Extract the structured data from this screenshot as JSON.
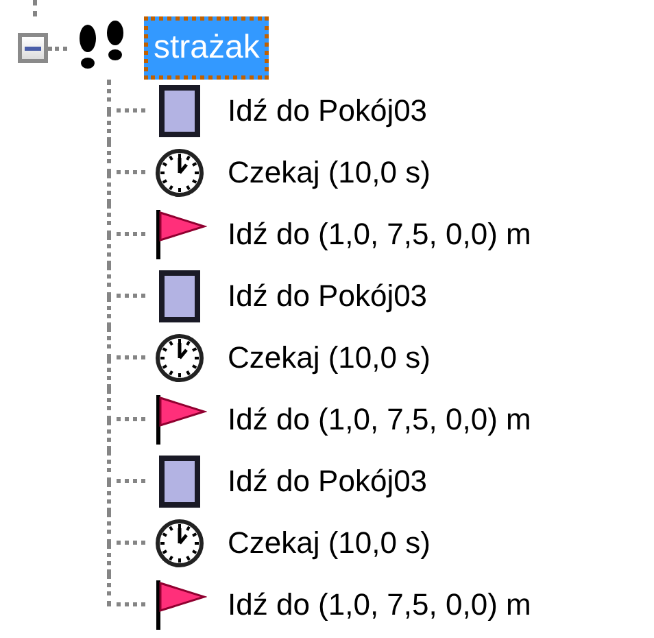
{
  "tree": {
    "label": "strażak",
    "expanded": true,
    "selected": true,
    "children": [
      {
        "kind": "room",
        "label": "Idź do Pokój03",
        "selected": false
      },
      {
        "kind": "wait",
        "label": "Czekaj (10,0 s)",
        "selected": false
      },
      {
        "kind": "goto",
        "label": "Idź do (1,0, 7,5, 0,0) m",
        "selected": false
      },
      {
        "kind": "room",
        "label": "Idź do Pokój03",
        "selected": false
      },
      {
        "kind": "wait",
        "label": "Czekaj (10,0 s)",
        "selected": false
      },
      {
        "kind": "goto",
        "label": "Idź do (1,0, 7,5, 0,0) m",
        "selected": false
      },
      {
        "kind": "room",
        "label": "Idź do Pokój03",
        "selected": false
      },
      {
        "kind": "wait",
        "label": "Czekaj (10,0 s)",
        "selected": false
      },
      {
        "kind": "goto",
        "label": "Idź do (1,0, 7,5, 0,0) m",
        "selected": false
      }
    ]
  }
}
